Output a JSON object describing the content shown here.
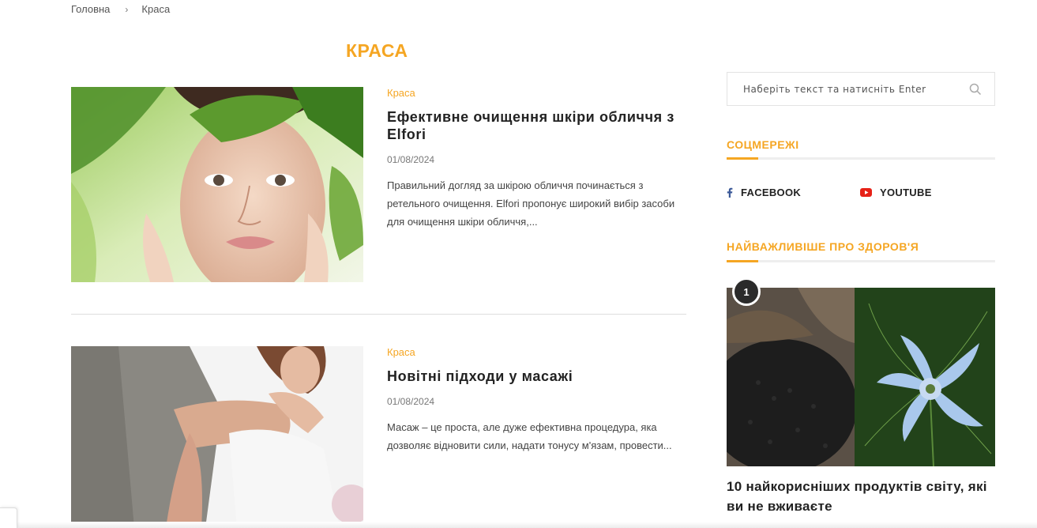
{
  "breadcrumb": {
    "home": "Головна",
    "separator": "›",
    "current": "Краса"
  },
  "page": {
    "title": "КРАСА"
  },
  "posts": [
    {
      "category": "Краса",
      "title": "Ефективне очищення шкіри обличчя з Elfori",
      "date": "01/08/2024",
      "excerpt": "Правильний догляд за шкірою обличчя починається з ретельного очищення. Elfori пропонує широкий вибір засоби для очищення шкіри обличчя,..."
    },
    {
      "category": "Краса",
      "title": "Новітні підходи у масажі",
      "date": "01/08/2024",
      "excerpt": "Масаж – це проста, але дуже ефективна процедура, яка дозволяє відновити сили, надати тонусу м'язам, провести..."
    }
  ],
  "sidebar": {
    "search": {
      "placeholder": "Наберіть текст та натисніть Enter"
    },
    "social": {
      "title": "СОЦМЕРЕЖІ",
      "items": [
        {
          "label": "FACEBOOK",
          "icon": "facebook-icon"
        },
        {
          "label": "YOUTUBE",
          "icon": "youtube-icon"
        }
      ]
    },
    "popular": {
      "title": "НАЙВАЖЛИВІШЕ ПРО ЗДОРОВ'Я",
      "items": [
        {
          "rank": "1",
          "title": "10 найкорисніших продуктів світу, які ви не вживаєте"
        }
      ]
    }
  },
  "colors": {
    "accent": "#f5a623",
    "text": "#222222",
    "youtube": "#e62117",
    "facebook": "#3b5998"
  }
}
